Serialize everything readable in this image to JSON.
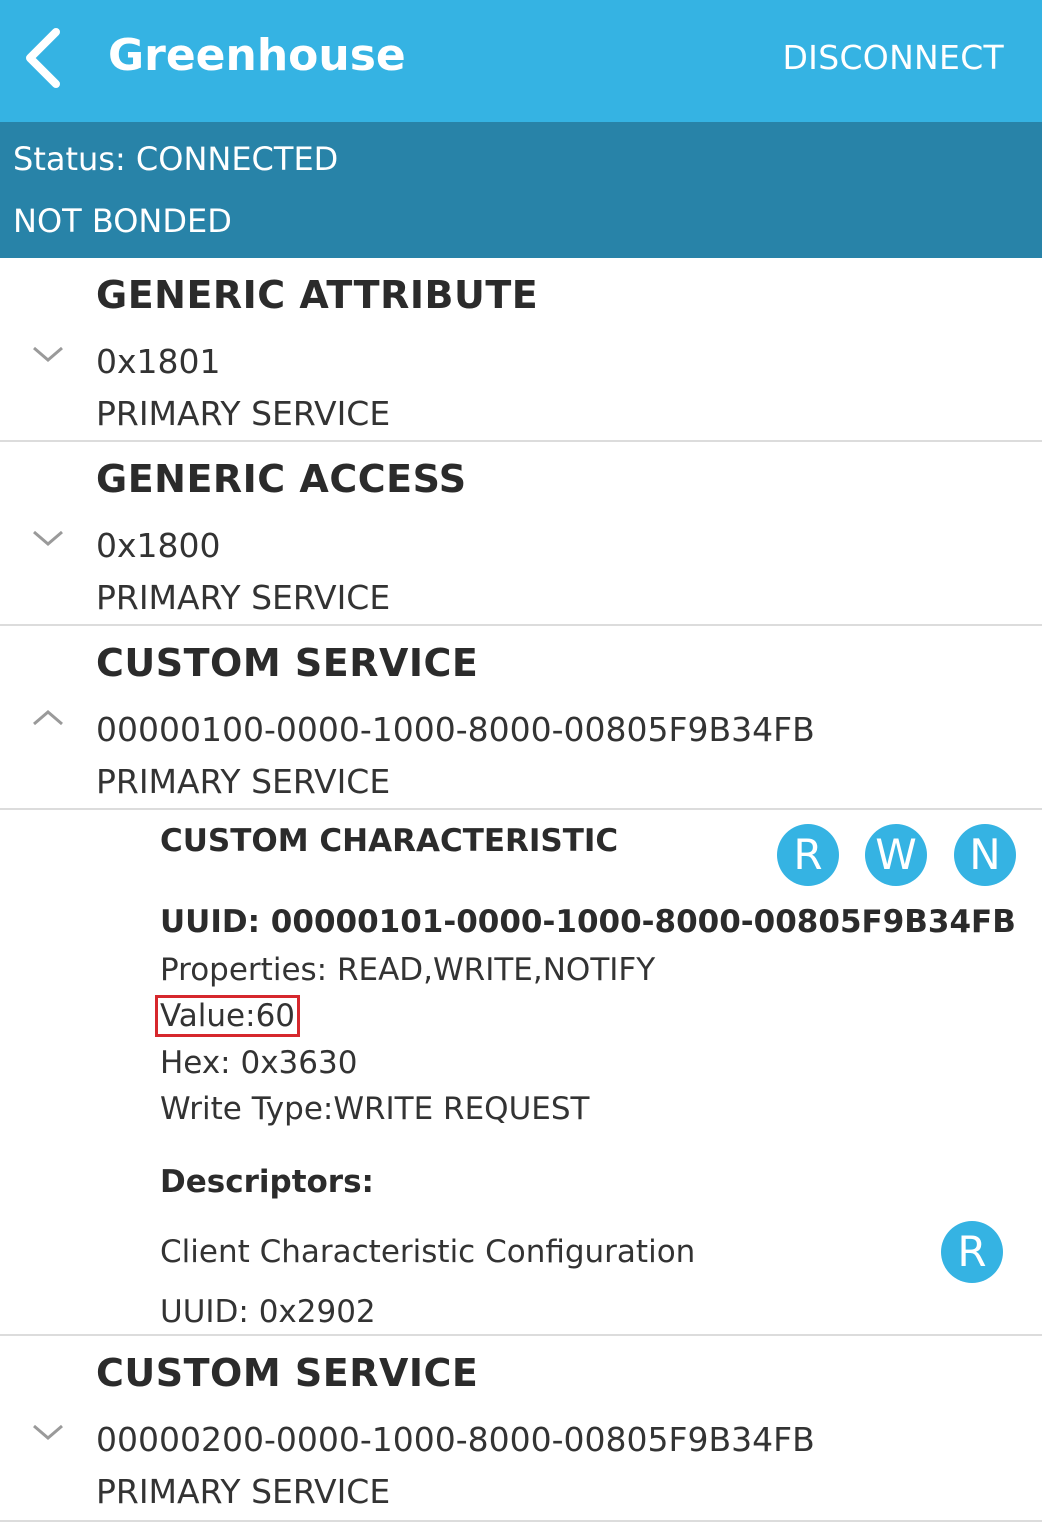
{
  "appbar": {
    "title": "Greenhouse",
    "disconnect_label": "DISCONNECT",
    "back_icon": "chevron-left-icon"
  },
  "status": {
    "connection": "Status: CONNECTED",
    "bond": "NOT BONDED"
  },
  "services": [
    {
      "name": "GENERIC ATTRIBUTE",
      "uuid": "0x1801",
      "type": "PRIMARY SERVICE",
      "expanded": false
    },
    {
      "name": "GENERIC ACCESS",
      "uuid": "0x1800",
      "type": "PRIMARY SERVICE",
      "expanded": false
    },
    {
      "name": "CUSTOM SERVICE",
      "uuid": "00000100-0000-1000-8000-00805F9B34FB",
      "type": "PRIMARY SERVICE",
      "expanded": true
    },
    {
      "name": "CUSTOM SERVICE",
      "uuid": "00000200-0000-1000-8000-00805F9B34FB",
      "type": "PRIMARY SERVICE",
      "expanded": false
    }
  ],
  "characteristic": {
    "name": "CUSTOM CHARACTERISTIC",
    "actions": [
      "R",
      "W",
      "N"
    ],
    "uuid": "UUID: 00000101-0000-1000-8000-00805F9B34FB",
    "properties": "Properties: READ,WRITE,NOTIFY",
    "value": "Value:60",
    "hex": "Hex: 0x3630",
    "write_type": "Write Type:WRITE REQUEST",
    "descriptors_label": "Descriptors:",
    "descriptor": {
      "name": "Client Characteristic Configuration",
      "uuid": "UUID: 0x2902",
      "action": "R"
    }
  },
  "colors": {
    "appbar": "#35b3e3",
    "statusbar": "#2883a8",
    "highlight": "#d6282d"
  }
}
